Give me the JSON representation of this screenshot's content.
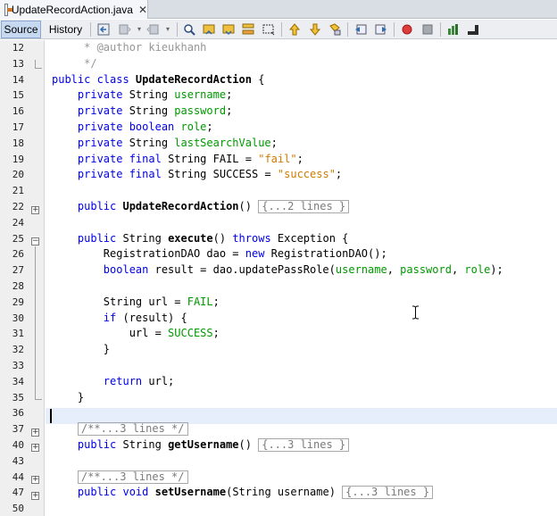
{
  "tab": {
    "title": "UpdateRecordAction.java",
    "close": "✕"
  },
  "toolbar": {
    "source_label": "Source",
    "history_label": "History"
  },
  "editor": {
    "lines": [
      {
        "n": "12",
        "tokens": [
          [
            "cmt",
            "     * @author kieukhanh"
          ]
        ]
      },
      {
        "n": "13",
        "tokens": [
          [
            "cmt",
            "     */"
          ]
        ]
      },
      {
        "n": "14",
        "tokens": [
          [
            "kw",
            "public class "
          ],
          [
            "mth",
            "UpdateRecordAction"
          ],
          [
            "",
            " {"
          ]
        ]
      },
      {
        "n": "15",
        "tokens": [
          [
            "",
            "    "
          ],
          [
            "kw",
            "private "
          ],
          [
            "",
            "String "
          ],
          [
            "fld",
            "username"
          ],
          [
            "",
            ";"
          ]
        ]
      },
      {
        "n": "16",
        "tokens": [
          [
            "",
            "    "
          ],
          [
            "kw",
            "private "
          ],
          [
            "",
            "String "
          ],
          [
            "fld",
            "password"
          ],
          [
            "",
            ";"
          ]
        ]
      },
      {
        "n": "17",
        "tokens": [
          [
            "",
            "    "
          ],
          [
            "kw",
            "private boolean "
          ],
          [
            "fld",
            "role"
          ],
          [
            "",
            ";"
          ]
        ]
      },
      {
        "n": "18",
        "tokens": [
          [
            "",
            "    "
          ],
          [
            "kw",
            "private "
          ],
          [
            "",
            "String "
          ],
          [
            "fld",
            "lastSearchValue"
          ],
          [
            "",
            ";"
          ]
        ]
      },
      {
        "n": "19",
        "tokens": [
          [
            "",
            "    "
          ],
          [
            "kw",
            "private final "
          ],
          [
            "",
            "String FAIL = "
          ],
          [
            "str",
            "\"fail\""
          ],
          [
            "",
            ";"
          ]
        ]
      },
      {
        "n": "20",
        "tokens": [
          [
            "",
            "    "
          ],
          [
            "kw",
            "private final "
          ],
          [
            "",
            "String SUCCESS = "
          ],
          [
            "str",
            "\"success\""
          ],
          [
            "",
            ";"
          ]
        ]
      },
      {
        "n": "21",
        "tokens": []
      },
      {
        "n": "22",
        "tokens": [
          [
            "",
            "    "
          ],
          [
            "kw",
            "public "
          ],
          [
            "mth",
            "UpdateRecordAction"
          ],
          [
            "",
            "() "
          ],
          [
            "box",
            "{...2 lines }"
          ]
        ]
      },
      {
        "n": "24",
        "tokens": []
      },
      {
        "n": "25",
        "tokens": [
          [
            "",
            "    "
          ],
          [
            "kw",
            "public "
          ],
          [
            "",
            "String "
          ],
          [
            "mth",
            "execute"
          ],
          [
            "",
            "() "
          ],
          [
            "kw",
            "throws "
          ],
          [
            "",
            "Exception {"
          ]
        ]
      },
      {
        "n": "26",
        "tokens": [
          [
            "",
            "        RegistrationDAO dao = "
          ],
          [
            "kw",
            "new "
          ],
          [
            "",
            "RegistrationDAO();"
          ]
        ]
      },
      {
        "n": "27",
        "tokens": [
          [
            "",
            "        "
          ],
          [
            "kw",
            "boolean "
          ],
          [
            "",
            "result = dao.updatePassRole("
          ],
          [
            "fld",
            "username"
          ],
          [
            "",
            ", "
          ],
          [
            "fld",
            "password"
          ],
          [
            "",
            ", "
          ],
          [
            "fld",
            "role"
          ],
          [
            "",
            ");"
          ]
        ]
      },
      {
        "n": "28",
        "tokens": []
      },
      {
        "n": "29",
        "tokens": [
          [
            "",
            "        String url = "
          ],
          [
            "fld",
            "FAIL"
          ],
          [
            "",
            ";"
          ]
        ]
      },
      {
        "n": "30",
        "tokens": [
          [
            "",
            "        "
          ],
          [
            "kw",
            "if "
          ],
          [
            "",
            "(result) {"
          ]
        ]
      },
      {
        "n": "31",
        "tokens": [
          [
            "",
            "            url = "
          ],
          [
            "fld",
            "SUCCESS"
          ],
          [
            "",
            ";"
          ]
        ]
      },
      {
        "n": "32",
        "tokens": [
          [
            "",
            "        }"
          ]
        ]
      },
      {
        "n": "33",
        "tokens": []
      },
      {
        "n": "34",
        "tokens": [
          [
            "",
            "        "
          ],
          [
            "kw",
            "return "
          ],
          [
            "",
            "url;"
          ]
        ]
      },
      {
        "n": "35",
        "tokens": [
          [
            "",
            "    }"
          ]
        ]
      },
      {
        "n": "36",
        "tokens": []
      },
      {
        "n": "37",
        "tokens": [
          [
            "",
            "    "
          ],
          [
            "box",
            "/**...3 lines */"
          ]
        ]
      },
      {
        "n": "40",
        "tokens": [
          [
            "",
            "    "
          ],
          [
            "kw",
            "public "
          ],
          [
            "",
            "String "
          ],
          [
            "mth",
            "getUsername"
          ],
          [
            "",
            "() "
          ],
          [
            "box",
            "{...3 lines }"
          ]
        ]
      },
      {
        "n": "43",
        "tokens": []
      },
      {
        "n": "44",
        "tokens": [
          [
            "",
            "    "
          ],
          [
            "box",
            "/**...3 lines */"
          ]
        ]
      },
      {
        "n": "47",
        "tokens": [
          [
            "",
            "    "
          ],
          [
            "kw",
            "public void "
          ],
          [
            "mth",
            "setUsername"
          ],
          [
            "",
            "(String username) "
          ],
          [
            "box",
            "{...3 lines }"
          ]
        ]
      },
      {
        "n": "50",
        "tokens": []
      }
    ]
  }
}
